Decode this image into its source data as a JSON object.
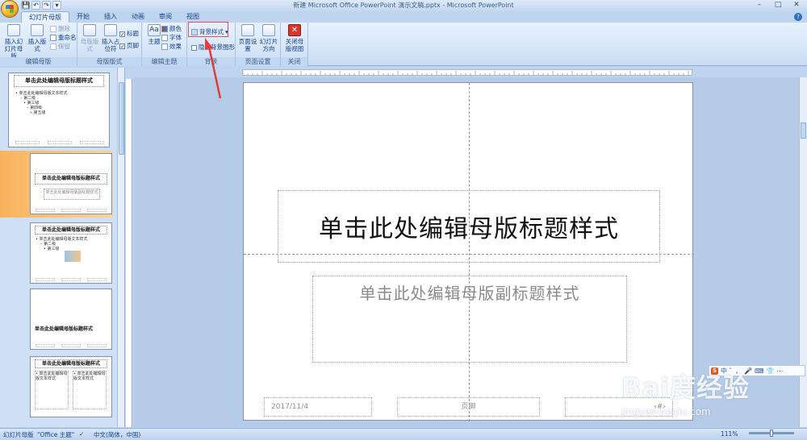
{
  "window": {
    "title": "新建 Microsoft Office PowerPoint 演示文稿.pptx - Microsoft PowerPoint",
    "controls": [
      "–",
      "□",
      "✕"
    ]
  },
  "quick_access": [
    "💾",
    "↶",
    "↷",
    "▾"
  ],
  "tabs": [
    "幻灯片母版",
    "开始",
    "插入",
    "动画",
    "审阅",
    "视图"
  ],
  "ribbon": {
    "edit_master": {
      "label": "编辑母版",
      "insert_slide_master": "插入幻灯片母版",
      "insert_layout": "插入版式",
      "delete": "删除",
      "rename": "重命名",
      "preserve": "保留"
    },
    "master_layout": {
      "label": "母版版式",
      "master_layout_btn": "母版版式",
      "insert_placeholder": "插入占位符",
      "title_check": "标题",
      "footer_check": "页脚"
    },
    "edit_theme": {
      "label": "编辑主题",
      "themes": "主题",
      "colors": "颜色",
      "fonts": "字体",
      "effects": "效果"
    },
    "background": {
      "label": "背景",
      "background_styles": "背景样式",
      "hide_background_graphics": "隐藏背景图形"
    },
    "page_setup": {
      "label": "页面设置",
      "page_setup_btn": "页面设置",
      "slide_orientation": "幻灯片方向"
    },
    "close": {
      "label": "关闭",
      "close_master_view": "关闭母版视图"
    }
  },
  "thumbnails": [
    {
      "title": "单击此处编辑母版标题样式",
      "body": [
        "• 单击此处编辑母版文本样式",
        "– 第二级",
        "• 第三级",
        "– 第四级",
        "» 第五级"
      ]
    },
    {
      "title": "单击此处编辑母版标题样式",
      "sub": "单击此处编辑母版副标题样式"
    },
    {
      "title": "单击此处编辑母版标题样式",
      "body": [
        "• 单击此处编辑母版文本样式",
        "– 第二级",
        "• 第三级"
      ]
    },
    {
      "title": "单击此处编辑母版标题样式"
    },
    {
      "title": "单击此处编辑母版标题样式",
      "body": [
        "• 单击此处编辑母版文本样式"
      ]
    }
  ],
  "slide": {
    "title": "单击此处编辑母版标题样式",
    "subtitle": "单击此处编辑母版副标题样式",
    "date": "2017/11/4",
    "footer": "页脚",
    "page_number": "‹#›"
  },
  "ime": {
    "icons": [
      "S",
      "中",
      "ﾟ",
      "，",
      "🎤",
      "⌨",
      "👕",
      "⋯"
    ]
  },
  "watermark": {
    "logo": "Bai度经验",
    "url": "jingyan.baidu.com"
  },
  "status": {
    "view": "幻灯片母版",
    "theme": "\"Office 主题\"",
    "language": "中文(简体，中国)",
    "zoom": "111%"
  }
}
